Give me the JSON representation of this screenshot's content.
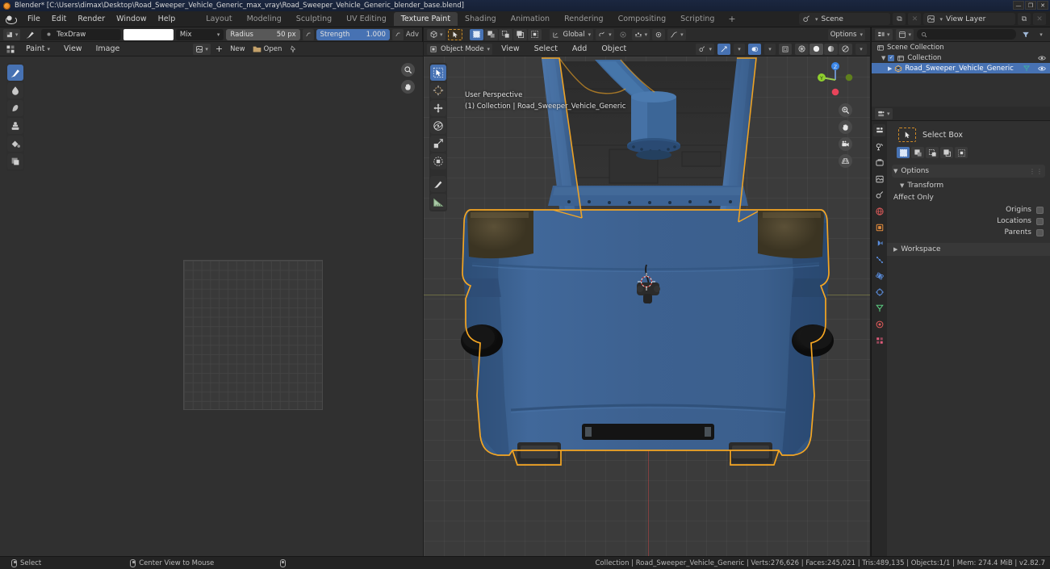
{
  "window": {
    "title": "Blender* [C:\\Users\\dimax\\Desktop\\Road_Sweeper_Vehicle_Generic_max_vray\\Road_Sweeper_Vehicle_Generic_blender_base.blend]",
    "minimize": "—",
    "maximize": "❐",
    "close": "✕"
  },
  "topbar": {
    "menus": [
      "File",
      "Edit",
      "Render",
      "Window",
      "Help"
    ],
    "workspaces": [
      {
        "label": "Layout",
        "active": false
      },
      {
        "label": "Modeling",
        "active": false
      },
      {
        "label": "Sculpting",
        "active": false
      },
      {
        "label": "UV Editing",
        "active": false
      },
      {
        "label": "Texture Paint",
        "active": true
      },
      {
        "label": "Shading",
        "active": false
      },
      {
        "label": "Animation",
        "active": false
      },
      {
        "label": "Rendering",
        "active": false
      },
      {
        "label": "Compositing",
        "active": false
      },
      {
        "label": "Scripting",
        "active": false
      }
    ],
    "add_workspace": "+",
    "scene": {
      "label": "Scene",
      "new_btn": "⧉",
      "unlink_btn": "✕"
    },
    "view_layer": {
      "label": "View Layer",
      "new_btn": "⧉",
      "unlink_btn": "✕"
    }
  },
  "image_editor": {
    "brush_name": "TexDraw",
    "blend_mode": "Mix",
    "color_swatch": "#ffffff",
    "radius": {
      "label": "Radius",
      "value": "50 px"
    },
    "strength": {
      "label": "Strength",
      "value": "1.000",
      "fill_pct": 100
    },
    "advanced_label": "Adv",
    "menus": [
      "Paint",
      "View",
      "Image"
    ],
    "new_button": "New",
    "open_button": "Open",
    "tools": [
      {
        "name": "draw-tool",
        "active": true
      },
      {
        "name": "soften-tool",
        "active": false
      },
      {
        "name": "smear-tool",
        "active": false
      },
      {
        "name": "clone-tool",
        "active": false
      },
      {
        "name": "fill-tool",
        "active": false
      },
      {
        "name": "mask-tool",
        "active": false
      }
    ],
    "zoom_icon": "⌕",
    "hand_icon": "✋"
  },
  "viewport": {
    "mode": "Object Mode",
    "menus": [
      "View",
      "Select",
      "Add",
      "Object"
    ],
    "transform_orientation": "Global",
    "options_label": "Options",
    "overlay_line1": "User Perspective",
    "overlay_line2": "(1) Collection | Road_Sweeper_Vehicle_Generic",
    "gizmo_axes": [
      {
        "label": "Z",
        "color": "#3a86e8"
      },
      {
        "label": "Y",
        "color": "#8fcf2e"
      },
      {
        "label": "X",
        "color": "#e8445a"
      }
    ],
    "nav_buttons": [
      "zoom-icon",
      "hand-icon",
      "camera-icon",
      "ortho-icon"
    ],
    "shading_modes": [
      "wireframe",
      "solid",
      "material-preview",
      "rendered"
    ],
    "tools": [
      {
        "name": "select-box-tool",
        "active": true
      },
      {
        "name": "cursor-tool",
        "active": false
      },
      {
        "name": "move-tool",
        "active": false
      },
      {
        "name": "rotate-tool",
        "active": false
      },
      {
        "name": "scale-tool",
        "active": false
      },
      {
        "name": "transform-tool",
        "active": false
      },
      {
        "name": "annotate-tool",
        "active": false
      },
      {
        "name": "measure-tool",
        "active": false
      }
    ],
    "model": {
      "body_color": "#3a618f",
      "body_shadow": "#2b4a70",
      "deck_color": "#2e2e2e",
      "accent_color": "#4c4329",
      "outline_color": "#f5a623"
    }
  },
  "outliner": {
    "search_placeholder": "",
    "rows": [
      {
        "label": "Scene Collection",
        "depth": 0,
        "selected": false,
        "icon": "collection-icon",
        "eye": false
      },
      {
        "label": "Collection",
        "depth": 1,
        "selected": false,
        "icon": "collection-icon",
        "eye": true
      },
      {
        "label": "Road_Sweeper_Vehicle_Generic",
        "depth": 2,
        "selected": true,
        "icon": "mesh-object-icon",
        "eye": true
      }
    ],
    "filter_icon": "filter-icon",
    "display_mode": "View Layer"
  },
  "properties": {
    "active_tool_name": "Select Box",
    "mode_buttons": [
      "set-new",
      "extend",
      "subtract",
      "invert",
      "intersect"
    ],
    "panels": [
      {
        "label": "Options",
        "open": true,
        "level": 0
      },
      {
        "label": "Transform",
        "open": true,
        "level": 1
      }
    ],
    "affect_only_label": "Affect Only",
    "checkboxes": [
      {
        "label": "Origins",
        "checked": false
      },
      {
        "label": "Locations",
        "checked": false
      },
      {
        "label": "Parents",
        "checked": false
      }
    ],
    "workspace_panel": {
      "label": "Workspace",
      "open": false
    },
    "tabs": [
      {
        "name": "tool-tab",
        "active": true,
        "color": "#cfcfcf"
      },
      {
        "name": "render-tab",
        "active": false,
        "color": "#cfcfcf"
      },
      {
        "name": "output-tab",
        "active": false,
        "color": "#cfcfcf"
      },
      {
        "name": "view-layer-tab",
        "active": false,
        "color": "#cfcfcf"
      },
      {
        "name": "scene-tab",
        "active": false,
        "color": "#cfcfcf"
      },
      {
        "name": "world-tab",
        "active": false,
        "color": "#e05b5b"
      },
      {
        "name": "object-tab",
        "active": false,
        "color": "#e08a3c"
      },
      {
        "name": "modifier-tab",
        "active": false,
        "color": "#5b8fe0"
      },
      {
        "name": "particles-tab",
        "active": false,
        "color": "#5b8fe0"
      },
      {
        "name": "physics-tab",
        "active": false,
        "color": "#5b8fe0"
      },
      {
        "name": "constraint-tab",
        "active": false,
        "color": "#5b8fe0"
      },
      {
        "name": "data-tab",
        "active": false,
        "color": "#5ac77e"
      },
      {
        "name": "material-tab",
        "active": false,
        "color": "#e05b5b"
      },
      {
        "name": "texture-tab",
        "active": false,
        "color": "#e05b7a"
      }
    ]
  },
  "statusbar": {
    "left_items": [
      {
        "icon": "mouse-left-icon",
        "label": "Select"
      },
      {
        "icon": "mouse-middle-icon",
        "label": "Center View to Mouse"
      },
      {
        "icon": "mouse-right-icon",
        "label": ""
      }
    ],
    "stats": "Collection | Road_Sweeper_Vehicle_Generic | Verts:276,626 | Faces:245,021 | Tris:489,135 | Objects:1/1 | Mem: 274.4 MiB | v2.82.7"
  }
}
